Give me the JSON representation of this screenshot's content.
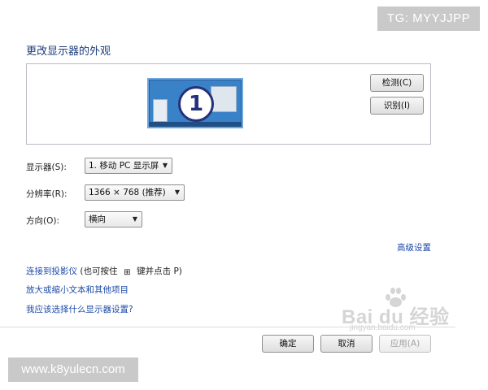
{
  "watermarks": {
    "top": "TG: MYYJJPP",
    "bottom": "www.k8yulecn.com",
    "baidu_brand": "Bai du 经验",
    "baidu_sub": "jingyan.baidu.com"
  },
  "page": {
    "title": "更改显示器的外观"
  },
  "monitor_panel": {
    "monitor_number": "1",
    "detect_label": "检测(C)",
    "identify_label": "识别(I)"
  },
  "settings": {
    "display_label": "显示器(S):",
    "display_value": "1. 移动 PC 显示屏",
    "resolution_label": "分辨率(R):",
    "resolution_value": "1366 × 768 (推荐)",
    "orientation_label": "方向(O):",
    "orientation_value": "横向",
    "advanced_link": "高级设置"
  },
  "links": {
    "projector_link": "连接到投影仪",
    "projector_hint_prefix": "(也可按住",
    "projector_hint_suffix": "键并点击 P)",
    "text_size_link": "放大或缩小文本和其他项目",
    "which_settings_link": "我应该选择什么显示器设置?"
  },
  "footer": {
    "ok_label": "确定",
    "cancel_label": "取消",
    "apply_label": "应用(A)"
  },
  "icons": {
    "windows_key": "windows-logo-icon",
    "dropdown": "chevron-down-icon"
  },
  "colors": {
    "link": "#1c4aa8",
    "title": "#1a3b7a",
    "monitor_fill": "#3a82c8"
  }
}
